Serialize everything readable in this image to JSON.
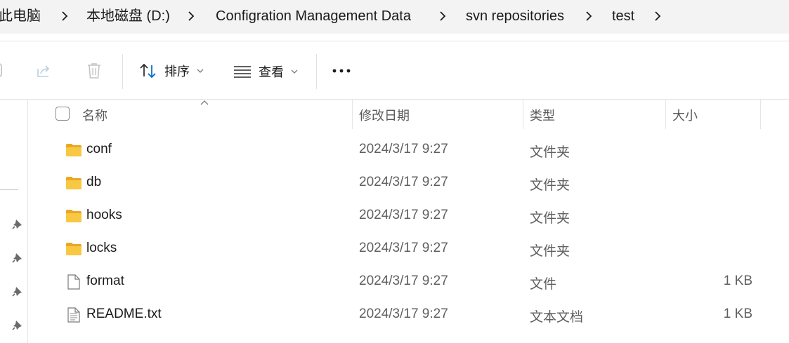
{
  "breadcrumb": {
    "items": [
      "此电脑",
      "本地磁盘 (D:)",
      "Configration Management Data",
      "svn repositories",
      "test"
    ]
  },
  "toolbar": {
    "sort_label": "排序",
    "view_label": "查看",
    "more_label": "•••"
  },
  "columns": {
    "name": "名称",
    "date": "修改日期",
    "type": "类型",
    "size": "大小"
  },
  "files": [
    {
      "name": "conf",
      "date": "2024/3/17 9:27",
      "type": "文件夹",
      "size": "",
      "icon": "folder-icon"
    },
    {
      "name": "db",
      "date": "2024/3/17 9:27",
      "type": "文件夹",
      "size": "",
      "icon": "folder-icon"
    },
    {
      "name": "hooks",
      "date": "2024/3/17 9:27",
      "type": "文件夹",
      "size": "",
      "icon": "folder-icon"
    },
    {
      "name": "locks",
      "date": "2024/3/17 9:27",
      "type": "文件夹",
      "size": "",
      "icon": "folder-icon"
    },
    {
      "name": "format",
      "date": "2024/3/17 9:27",
      "type": "文件",
      "size": "1 KB",
      "icon": "file-icon"
    },
    {
      "name": "README.txt",
      "date": "2024/3/17 9:27",
      "type": "文本文档",
      "size": "1 KB",
      "icon": "text-file-icon"
    }
  ],
  "colors": {
    "breadcrumb_bg": "#f3f3f3",
    "folder_yellow": "#f8c842",
    "accent_blue": "#0067c0"
  }
}
